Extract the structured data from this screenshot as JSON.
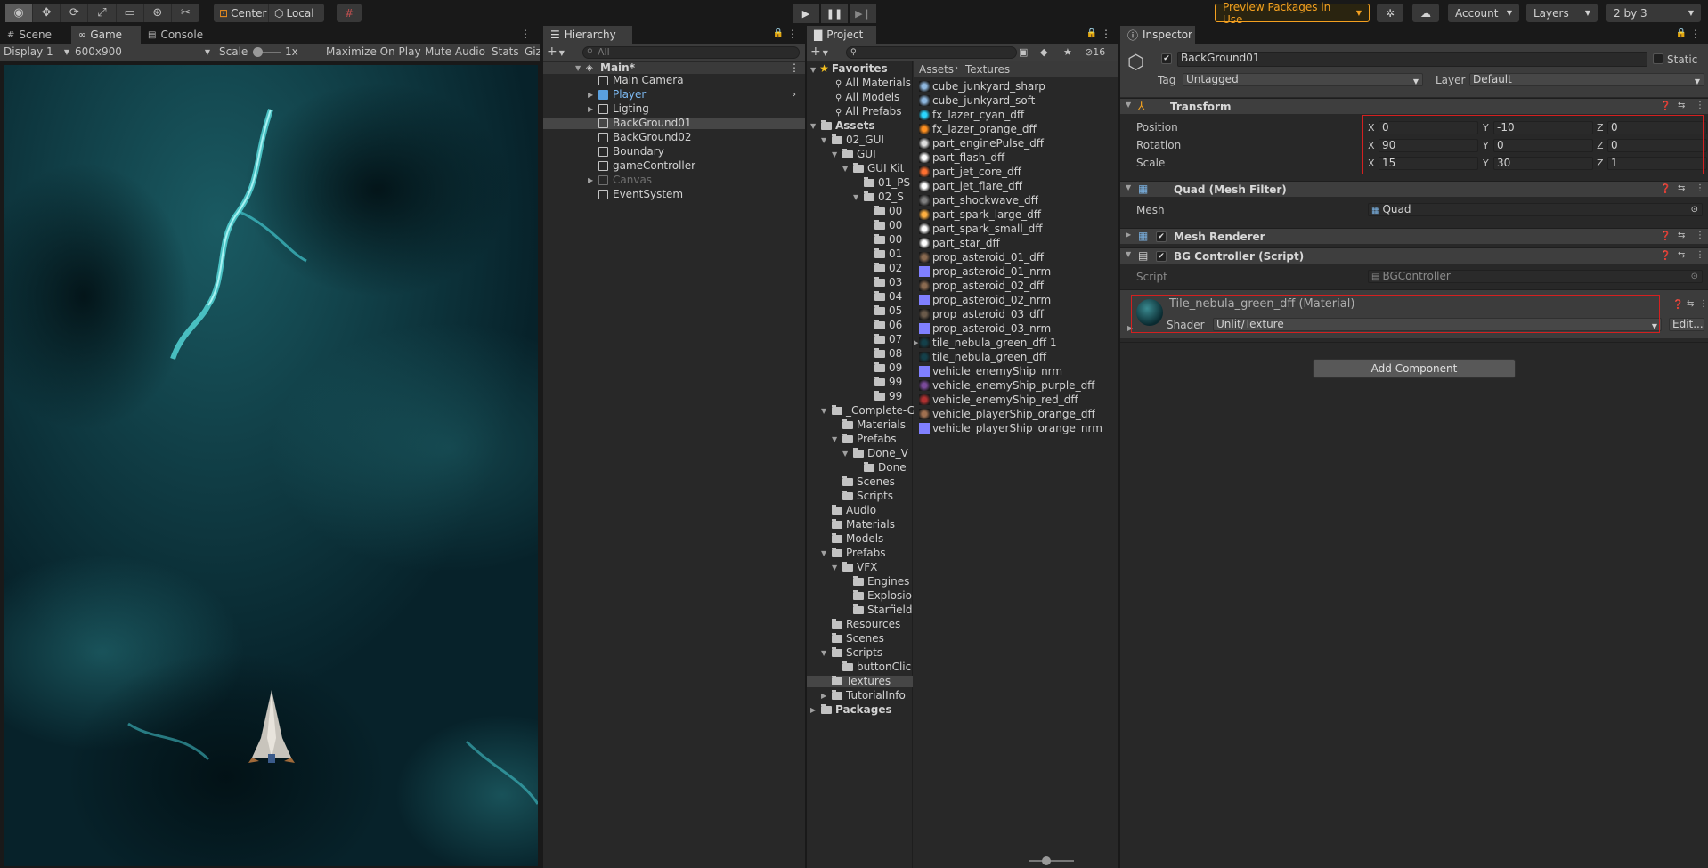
{
  "toolbar": {
    "tools": [
      "view-tool",
      "move-tool",
      "rotate-tool",
      "scale-tool",
      "rect-tool",
      "transform-tool",
      "custom-tool"
    ],
    "pivot": "Center",
    "space": "Local",
    "preview_packages": "Preview Packages in Use",
    "account": "Account",
    "layers": "Layers",
    "layout": "2 by 3"
  },
  "game_view": {
    "tabs": [
      "Scene",
      "Game",
      "Console"
    ],
    "display": "Display 1",
    "resolution": "600x900",
    "scale_label": "Scale",
    "scale_value": "1x",
    "maximize": "Maximize On Play",
    "mute": "Mute Audio",
    "stats": "Stats",
    "gizmos": "Giz"
  },
  "hierarchy": {
    "title": "Hierarchy",
    "search_placeholder": "All",
    "scene": "Main*",
    "items": [
      {
        "label": "Main Camera",
        "expandable": false
      },
      {
        "label": "Player",
        "expandable": true,
        "prefab": true
      },
      {
        "label": "Ligting",
        "expandable": true
      },
      {
        "label": "BackGround01",
        "expandable": false,
        "selected": true
      },
      {
        "label": "BackGround02",
        "expandable": false
      },
      {
        "label": "Boundary",
        "expandable": false
      },
      {
        "label": "gameController",
        "expandable": false
      },
      {
        "label": "Canvas",
        "expandable": true,
        "disabled": true
      },
      {
        "label": "EventSystem",
        "expandable": false
      }
    ]
  },
  "project": {
    "title": "Project",
    "hidden_count": "16",
    "breadcrumb": [
      "Assets",
      "Textures"
    ],
    "favorites": {
      "label": "Favorites",
      "items": [
        "All Materials",
        "All Models",
        "All Prefabs"
      ]
    },
    "tree": [
      {
        "label": "Assets",
        "depth": 0,
        "bold": true,
        "open": true
      },
      {
        "label": "02_GUI",
        "depth": 1,
        "open": true
      },
      {
        "label": "GUI",
        "depth": 2,
        "open": true
      },
      {
        "label": "GUI Kit",
        "depth": 3,
        "open": true
      },
      {
        "label": "01_PS",
        "depth": 4
      },
      {
        "label": "02_S",
        "depth": 4,
        "open": true
      },
      {
        "label": "00",
        "depth": 5
      },
      {
        "label": "00",
        "depth": 5
      },
      {
        "label": "00",
        "depth": 5
      },
      {
        "label": "01",
        "depth": 5
      },
      {
        "label": "02",
        "depth": 5
      },
      {
        "label": "03",
        "depth": 5
      },
      {
        "label": "04",
        "depth": 5
      },
      {
        "label": "05",
        "depth": 5
      },
      {
        "label": "06",
        "depth": 5
      },
      {
        "label": "07",
        "depth": 5
      },
      {
        "label": "08",
        "depth": 5
      },
      {
        "label": "09",
        "depth": 5
      },
      {
        "label": "99",
        "depth": 5
      },
      {
        "label": "99",
        "depth": 5
      },
      {
        "label": "_Complete-G",
        "depth": 1,
        "open": true
      },
      {
        "label": "Materials",
        "depth": 2
      },
      {
        "label": "Prefabs",
        "depth": 2,
        "open": true
      },
      {
        "label": "Done_V",
        "depth": 3,
        "open": true
      },
      {
        "label": "Done",
        "depth": 4
      },
      {
        "label": "Scenes",
        "depth": 2
      },
      {
        "label": "Scripts",
        "depth": 2
      },
      {
        "label": "Audio",
        "depth": 1
      },
      {
        "label": "Materials",
        "depth": 1
      },
      {
        "label": "Models",
        "depth": 1
      },
      {
        "label": "Prefabs",
        "depth": 1,
        "open": true
      },
      {
        "label": "VFX",
        "depth": 2,
        "open": true
      },
      {
        "label": "Engines",
        "depth": 3
      },
      {
        "label": "Explosio",
        "depth": 3
      },
      {
        "label": "Starfield",
        "depth": 3
      },
      {
        "label": "Resources",
        "depth": 1
      },
      {
        "label": "Scenes",
        "depth": 1
      },
      {
        "label": "Scripts",
        "depth": 1,
        "open": true
      },
      {
        "label": "buttonClic",
        "depth": 2
      },
      {
        "label": "Textures",
        "depth": 1,
        "selected": true
      },
      {
        "label": "TutorialInfo",
        "depth": 1,
        "closed": true
      },
      {
        "label": "Packages",
        "depth": 0,
        "bold": true,
        "closed": true
      }
    ],
    "files": [
      {
        "label": "cube_junkyard_sharp",
        "color": "#8fb8e0"
      },
      {
        "label": "cube_junkyard_soft",
        "color": "#8fb8e0"
      },
      {
        "label": "fx_lazer_cyan_dff",
        "color": "#2ad6ff"
      },
      {
        "label": "fx_lazer_orange_dff",
        "color": "#ff9020"
      },
      {
        "label": "part_enginePulse_dff",
        "color": "#e0e0e0"
      },
      {
        "label": "part_flash_dff",
        "color": "#ffffff"
      },
      {
        "label": "part_jet_core_dff",
        "color": "#ff7030"
      },
      {
        "label": "part_jet_flare_dff",
        "color": "#ffffff"
      },
      {
        "label": "part_shockwave_dff",
        "color": "#808080"
      },
      {
        "label": "part_spark_large_dff",
        "color": "#ffb040"
      },
      {
        "label": "part_spark_small_dff",
        "color": "#ffffff"
      },
      {
        "label": "part_star_dff",
        "color": "#ffffff"
      },
      {
        "label": "prop_asteroid_01_dff",
        "color": "#8a6a50"
      },
      {
        "label": "prop_asteroid_01_nrm",
        "color": "#8080ff"
      },
      {
        "label": "prop_asteroid_02_dff",
        "color": "#8a6a50"
      },
      {
        "label": "prop_asteroid_02_nrm",
        "color": "#8080ff"
      },
      {
        "label": "prop_asteroid_03_dff",
        "color": "#6a5a4a"
      },
      {
        "label": "prop_asteroid_03_nrm",
        "color": "#8080ff"
      },
      {
        "label": "tile_nebula_green_dff 1",
        "color": "#14404a"
      },
      {
        "label": "tile_nebula_green_dff",
        "color": "#14404a"
      },
      {
        "label": "vehicle_enemyShip_nrm",
        "color": "#8080ff"
      },
      {
        "label": "vehicle_enemyShip_purple_dff",
        "color": "#7a4a9a"
      },
      {
        "label": "vehicle_enemyShip_red_dff",
        "color": "#b03030"
      },
      {
        "label": "vehicle_playerShip_orange_dff",
        "color": "#a07050"
      },
      {
        "label": "vehicle_playerShip_orange_nrm",
        "color": "#8080ff"
      }
    ]
  },
  "inspector": {
    "title": "Inspector",
    "object_name": "BackGround01",
    "static_label": "Static",
    "tag_label": "Tag",
    "tag_value": "Untagged",
    "layer_label": "Layer",
    "layer_value": "Default",
    "transform": {
      "title": "Transform",
      "rows": [
        {
          "label": "Position",
          "x": "0",
          "y": "-10",
          "z": "0"
        },
        {
          "label": "Rotation",
          "x": "90",
          "y": "0",
          "z": "0"
        },
        {
          "label": "Scale",
          "x": "15",
          "y": "30",
          "z": "1"
        }
      ]
    },
    "mesh_filter": {
      "title": "Quad (Mesh Filter)",
      "mesh_label": "Mesh",
      "mesh_value": "Quad"
    },
    "mesh_renderer": {
      "title": "Mesh Renderer"
    },
    "bg_controller": {
      "title": "BG Controller (Script)",
      "script_label": "Script",
      "script_value": "BGController"
    },
    "material": {
      "name": "Tile_nebula_green_dff (Material)",
      "shader_label": "Shader",
      "shader_value": "Unlit/Texture",
      "edit": "Edit..."
    },
    "add_component": "Add Component"
  },
  "colors": {
    "accent_orange": "#f4a020",
    "highlight_red": "#d42020",
    "selection": "#464646"
  }
}
